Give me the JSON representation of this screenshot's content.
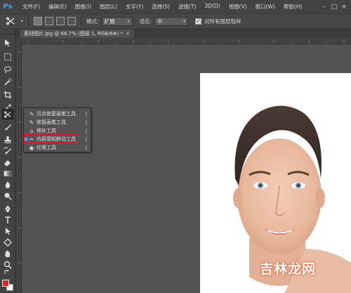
{
  "app": {
    "logo": "Ps"
  },
  "menubar": {
    "items": [
      "文件(F)",
      "编辑(E)",
      "图像(I)",
      "图层(L)",
      "文字(Y)",
      "选择(S)",
      "滤镜(T)",
      "3D(D)",
      "视图(V)",
      "窗口(W)",
      "帮助(H)"
    ],
    "window_controls": [
      "–",
      "□",
      "×"
    ]
  },
  "options_bar": {
    "mode_label": "模式:",
    "mode_value": "扩展",
    "adapt_label": "适应:",
    "adapt_value": "中",
    "sample_all_layers_label": "对所有图层取样",
    "sample_all_layers_checked": true
  },
  "document_tab": {
    "title": "素材图片.jpg @ 66.7% (图层 1, RGB/8#) *",
    "close": "×"
  },
  "flyout": {
    "items": [
      {
        "icon": "spot-healing-brush-icon",
        "label": "污点修复画笔工具",
        "key": "J",
        "active": false
      },
      {
        "icon": "healing-brush-icon",
        "label": "修复画笔工具",
        "key": "J",
        "active": false
      },
      {
        "icon": "patch-icon",
        "label": "修补工具",
        "key": "J",
        "active": false
      },
      {
        "icon": "content-aware-move-icon",
        "label": "内容感知移动工具",
        "key": "J",
        "active": true
      },
      {
        "icon": "red-eye-icon",
        "label": "红眼工具",
        "key": "J",
        "active": false
      }
    ]
  },
  "colors": {
    "foreground": "#e81f24",
    "background": "#ffffff",
    "highlight": "#e51d24"
  },
  "watermark": {
    "text": "吉林龙网"
  }
}
